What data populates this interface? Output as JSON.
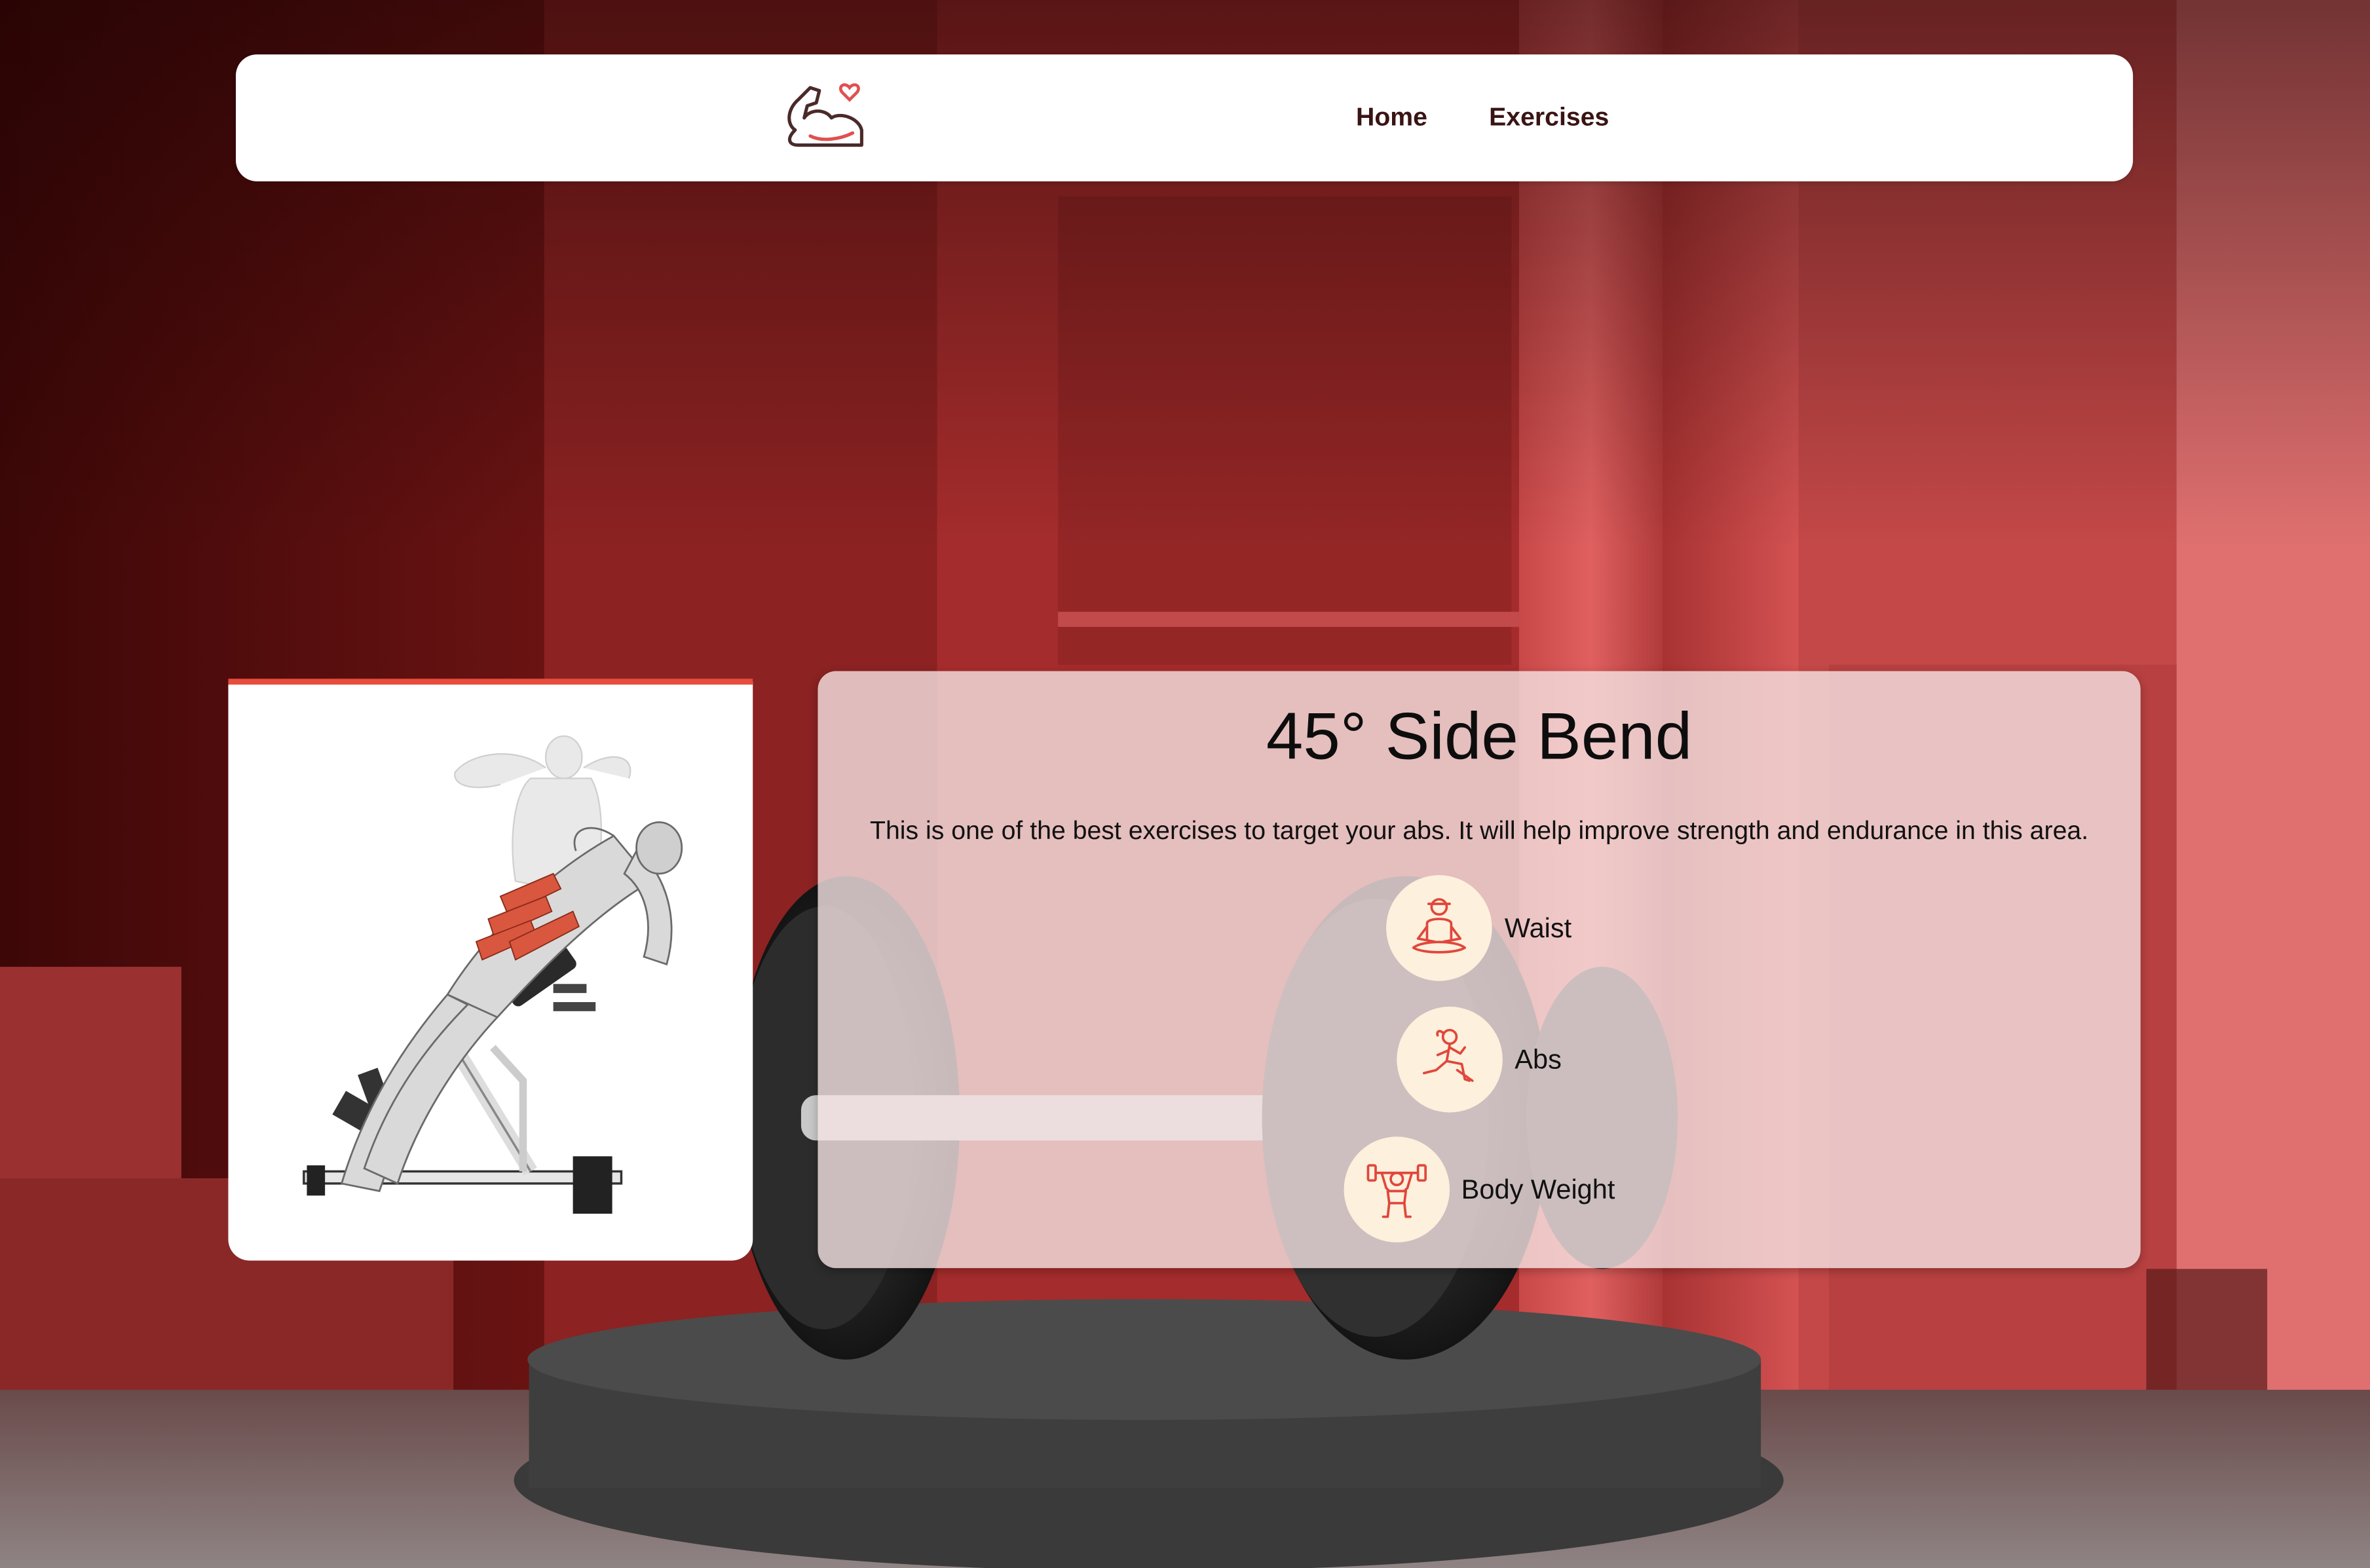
{
  "nav": {
    "home_label": "Home",
    "exercises_label": "Exercises"
  },
  "exercise": {
    "title": "45° Side Bend",
    "description": "This is one of the best exercises to target your abs. It will help improve strength and endurance in this area.",
    "tags": [
      {
        "label": "Waist",
        "icon": "meditation-pose-icon"
      },
      {
        "label": "Abs",
        "icon": "lunge-pose-icon"
      },
      {
        "label": "Body Weight",
        "icon": "weightlifter-icon"
      }
    ]
  },
  "colors": {
    "accent": "#e74c3c",
    "nav_text": "#3a1414",
    "tag_circle": "#fdf0dc",
    "panel_bg": "#f5e4e4"
  }
}
